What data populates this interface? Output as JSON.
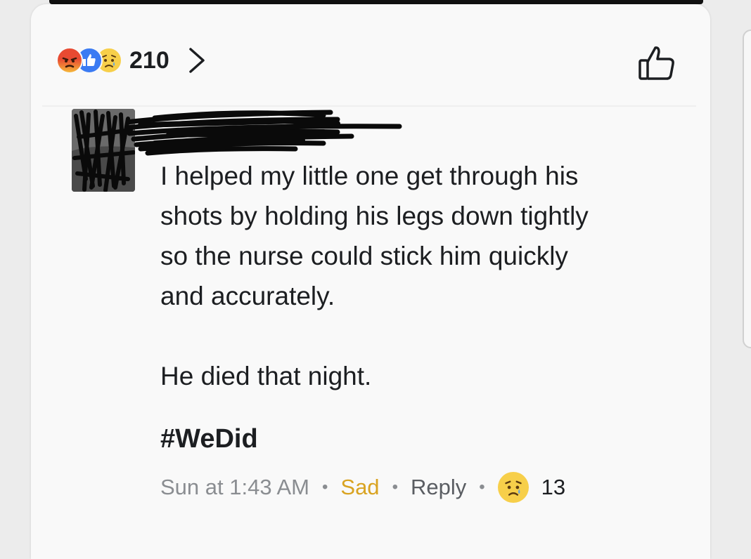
{
  "reactions": {
    "icons": [
      "angry-icon",
      "like-icon",
      "sad-icon"
    ],
    "count": "210",
    "colors": {
      "angry": "#e84a32",
      "like": "#3b7bf3",
      "sad": "#f7cf4a"
    }
  },
  "comment": {
    "text": "I helped my little one get through his\nshots by holding his legs down tightly\nso the nurse could stick him quickly\nand accurately.\n\nHe died that night.",
    "hashtag": "#WeDid"
  },
  "meta": {
    "time": "Sun at 1:43 AM",
    "reaction_label": "Sad",
    "reply_label": "Reply",
    "reaction_count": "13"
  }
}
